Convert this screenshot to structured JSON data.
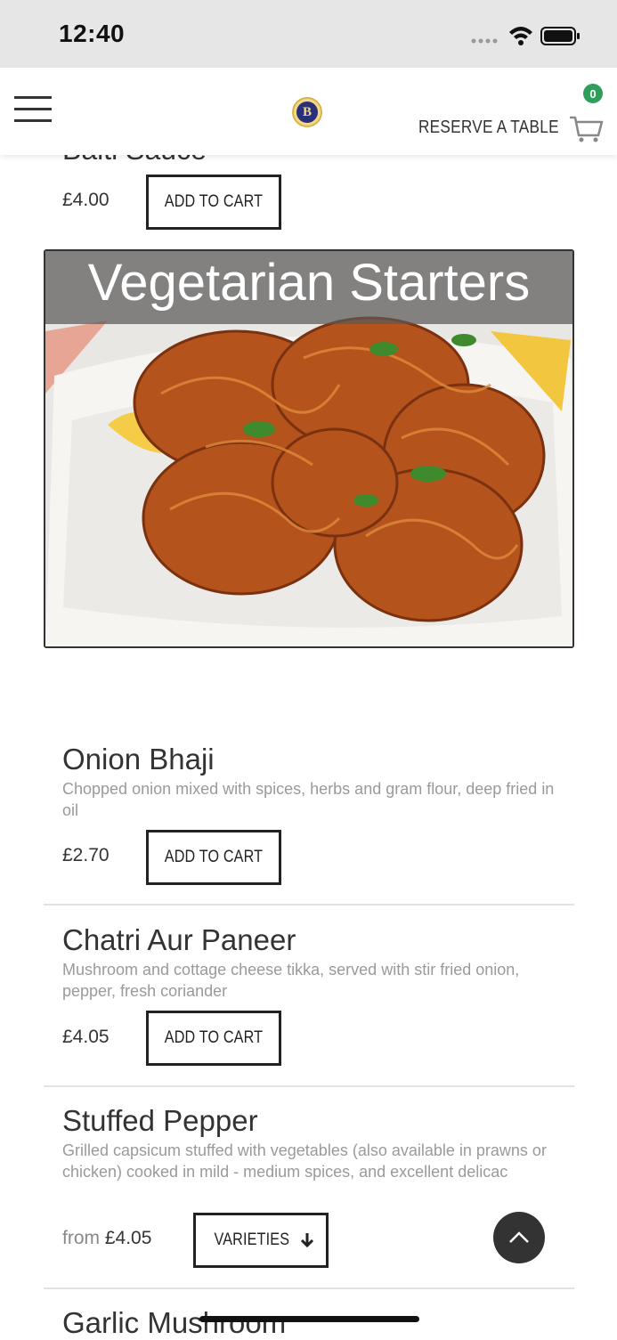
{
  "status_bar": {
    "time": "12:40"
  },
  "nav": {
    "reserve_label": "RESERVE A TABLE",
    "cart_count": "0",
    "logo_letter": "B"
  },
  "previous_item": {
    "name": "Balti Sauce",
    "price": "£4.00",
    "button": "ADD TO CART"
  },
  "section": {
    "title": "Vegetarian Starters"
  },
  "items": [
    {
      "name": "Onion Bhaji",
      "description": "Chopped onion mixed with spices, herbs and gram flour, deep fried in oil",
      "price": "£2.70",
      "button": "ADD TO CART"
    },
    {
      "name": "Chatri Aur Paneer",
      "description": "Mushroom and cottage cheese tikka, served with stir fried onion, pepper, fresh coriander",
      "price": "£4.05",
      "button": "ADD TO CART"
    },
    {
      "name": "Stuffed Pepper",
      "description": "Grilled capsicum stuffed with vegetables (also available in prawns or chicken) cooked in mild - medium spices, and excellent delicac",
      "price_prefix": "from",
      "price": "£4.05",
      "button": "VARIETIES"
    },
    {
      "name": "Garlic Mushroom"
    }
  ]
}
